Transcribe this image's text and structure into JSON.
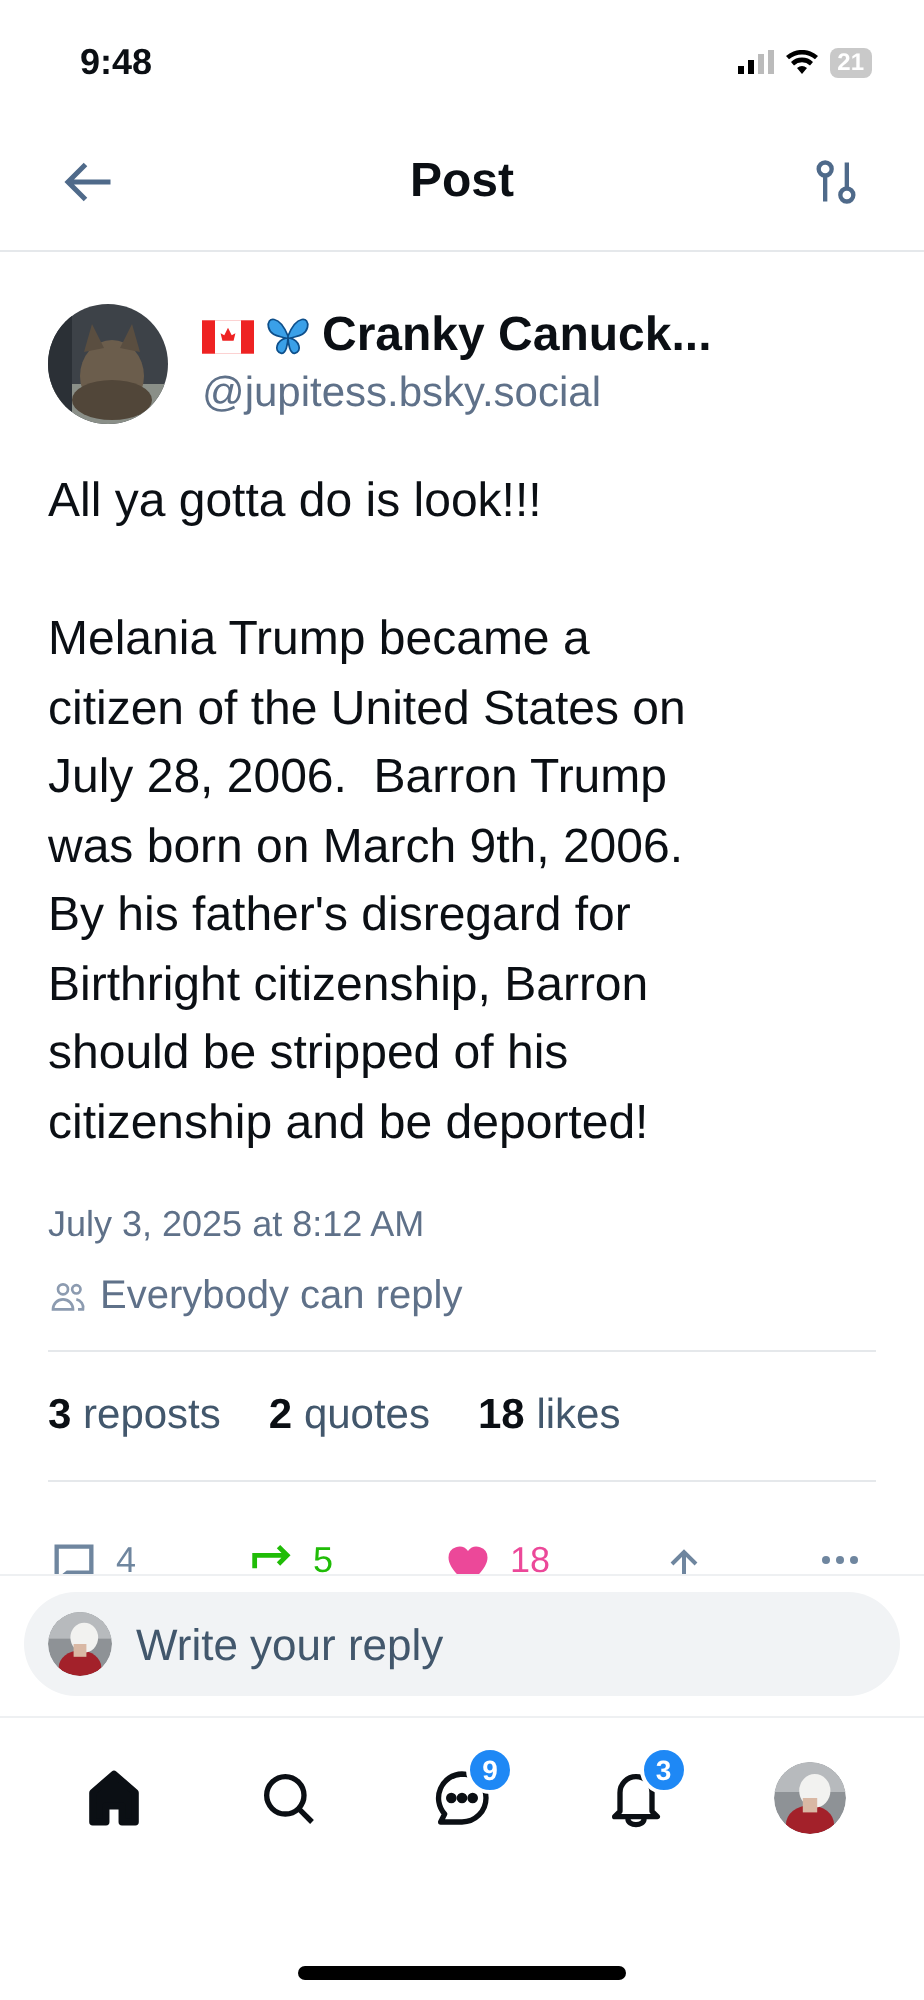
{
  "status_bar": {
    "time": "9:48",
    "battery": "21"
  },
  "header": {
    "title": "Post"
  },
  "author": {
    "display_name": "Cranky Canuck...",
    "handle": "@jupitess.bsky.social"
  },
  "post": {
    "text": "All ya gotta do is look!!!\n\nMelania Trump became a\ncitizen of the United States on\nJuly 28, 2006.  Barron Trump\nwas born on March 9th, 2006.\nBy his father's disregard for\nBirthright citizenship, Barron\nshould be stripped of his\ncitizenship and be deported!",
    "timestamp": "July 3, 2025 at 8:12 AM",
    "reply_setting": "Everybody can reply"
  },
  "stats": [
    {
      "count": "3",
      "label": "reposts"
    },
    {
      "count": "2",
      "label": "quotes"
    },
    {
      "count": "18",
      "label": "likes"
    }
  ],
  "actions": [
    {
      "kind": "reply",
      "count": "4"
    },
    {
      "kind": "repost",
      "count": "5"
    },
    {
      "kind": "like",
      "count": "18"
    },
    {
      "kind": "share"
    },
    {
      "kind": "more"
    }
  ],
  "reply_bar": {
    "placeholder": "Write your reply"
  },
  "tab_bar": [
    {
      "kind": "home",
      "selected": true
    },
    {
      "kind": "search",
      "selected": false
    },
    {
      "kind": "chat",
      "selected": false,
      "badge": "9"
    },
    {
      "kind": "notifications",
      "selected": false,
      "badge": "3"
    },
    {
      "kind": "profile",
      "selected": false
    }
  ]
}
